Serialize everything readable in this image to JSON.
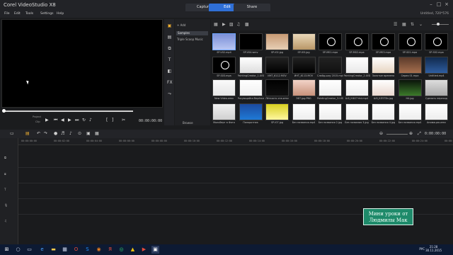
{
  "app": {
    "title": "Corel VideoStudio X8",
    "project": "Untitled, 720*576"
  },
  "tabs": [
    {
      "label": "Capture"
    },
    {
      "label": "Edit",
      "active": true
    },
    {
      "label": "Share"
    }
  ],
  "menu": [
    "File",
    "Edit",
    "Tools",
    "Settings",
    "Help"
  ],
  "player": {
    "project_label": "Project",
    "clip_label": "Clip",
    "timecode": "00:00:00:00"
  },
  "library": {
    "add_label": "Add",
    "folders": [
      "Samples",
      "Triple Scoop Music"
    ],
    "browse_label": "Browse",
    "thumbs": [
      [
        "SP-V02.mp4",
        "SP-V04.wmv",
        "SP-I02.jpg",
        "SP-I03.jpg",
        "SP-M01.mpa",
        "SP-M02.mpa",
        "SP-M03.mpa",
        "SP-S01.mpa",
        "SP-S02.mpa"
      ],
      [
        "SP-S03.mpa",
        "PaintingCreator_1.UISP",
        "ИНТ_6112.MOV",
        "ИНТ_6113.MOV",
        "Слайд-шоу 2015.mp4",
        "PaintingCreator_2.UISP",
        "Золотые времена",
        "Серия 01.mpa",
        "Untitled.mp4"
      ],
      [
        "New Video.wmv",
        "Рисующийся берёзка",
        "Лёгкость сна.wmv",
        "ЭБТ.jpg.PNG",
        "PaintingCreator_3.UISP",
        "Ш0_КФ27тhd.mp4",
        "Ш9_КЛ5Т8н.jpg",
        "H4.jpg",
        "Сделать переход"
      ],
      [
        "Мольберт в Фото",
        "Папоротник",
        "SP-I07.jpg",
        "Без названия.mp4",
        "Без названия 2.jpg",
        "Без названия 3.jpg",
        "Без названия 4.jpg",
        "Без названия.mp4",
        "Анимация.wmv"
      ]
    ]
  },
  "timeline": {
    "ruler": [
      "00:00:00:00",
      "00:00:02:00",
      "00:00:04:00",
      "00:00:06:00",
      "00:00:08:00",
      "00:00:10:00",
      "00:00:12:00",
      "00:00:14:00",
      "00:00:16:00",
      "00:00:18:00",
      "00:00:20:00",
      "00:00:22:00",
      "00:00:24:00",
      "00:00:26:00"
    ],
    "duration": "0:00:00:00"
  },
  "watermark": {
    "line1": "Мини уроки от",
    "line2": "Людмилы Мак"
  },
  "taskbar": {
    "lang": "РУС",
    "time": "21:28",
    "date": "30.11.2015"
  },
  "colors": {
    "accent": "#2f6fd6",
    "watermark_bg": "#1e8a6a"
  }
}
